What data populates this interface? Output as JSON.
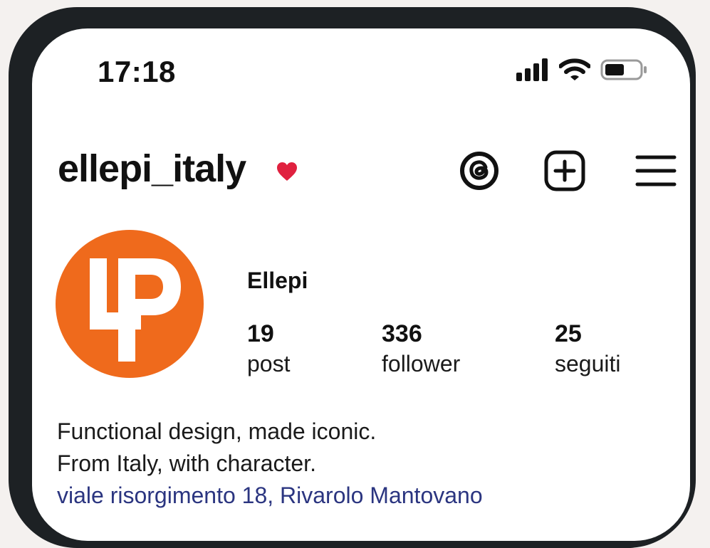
{
  "status_bar": {
    "time": "17:18",
    "icons": [
      "cellular-signal-icon",
      "wifi-icon",
      "battery-icon"
    ]
  },
  "header": {
    "username": "ellepi_italy",
    "heart_color": "#e0213f",
    "actions": [
      "threads-icon",
      "add-post-icon",
      "menu-icon"
    ]
  },
  "profile": {
    "avatar_logo_text": "LP",
    "avatar_color": "#ef6a1c",
    "display_name": "Ellepi",
    "stats": [
      {
        "number": "19",
        "label": "post"
      },
      {
        "number": "336",
        "label": "follower"
      },
      {
        "number": "25",
        "label": "seguiti"
      }
    ]
  },
  "bio": {
    "line1": "Functional design, made iconic.",
    "line2": "From Italy, with character.",
    "address": "viale risorgimento 18, Rivarolo Mantovano",
    "address_color": "#2b3580"
  }
}
